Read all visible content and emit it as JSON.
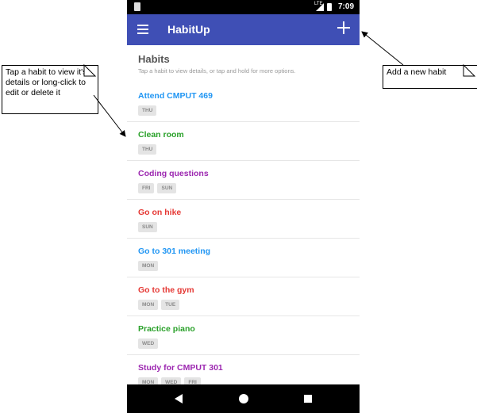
{
  "status_bar": {
    "network": "LTE",
    "time": "7:09"
  },
  "app_bar": {
    "title": "HabitUp"
  },
  "content": {
    "heading": "Habits",
    "subheading": "Tap a habit to view details, or tap and hold for more options."
  },
  "habits": [
    {
      "name": "Attend CMPUT 469",
      "color": "#2196f3",
      "days": [
        "THU"
      ]
    },
    {
      "name": "Clean room",
      "color": "#2aa12a",
      "days": [
        "THU"
      ]
    },
    {
      "name": "Coding questions",
      "color": "#9c27b0",
      "days": [
        "FRI",
        "SUN"
      ]
    },
    {
      "name": "Go on hike",
      "color": "#e53935",
      "days": [
        "SUN"
      ]
    },
    {
      "name": "Go to 301 meeting",
      "color": "#2196f3",
      "days": [
        "MON"
      ]
    },
    {
      "name": "Go to the gym",
      "color": "#e53935",
      "days": [
        "MON",
        "TUE"
      ]
    },
    {
      "name": "Practice piano",
      "color": "#2aa12a",
      "days": [
        "WED"
      ]
    },
    {
      "name": "Study for CMPUT 301",
      "color": "#9c27b0",
      "days": [
        "MON",
        "WED",
        "FRI"
      ]
    }
  ],
  "annotations": {
    "left_note": "Tap a habit to view it's details or long-click to edit or delete it",
    "right_note": "Add a new habit"
  },
  "colors": {
    "app_bar": "#3f4fb5"
  }
}
